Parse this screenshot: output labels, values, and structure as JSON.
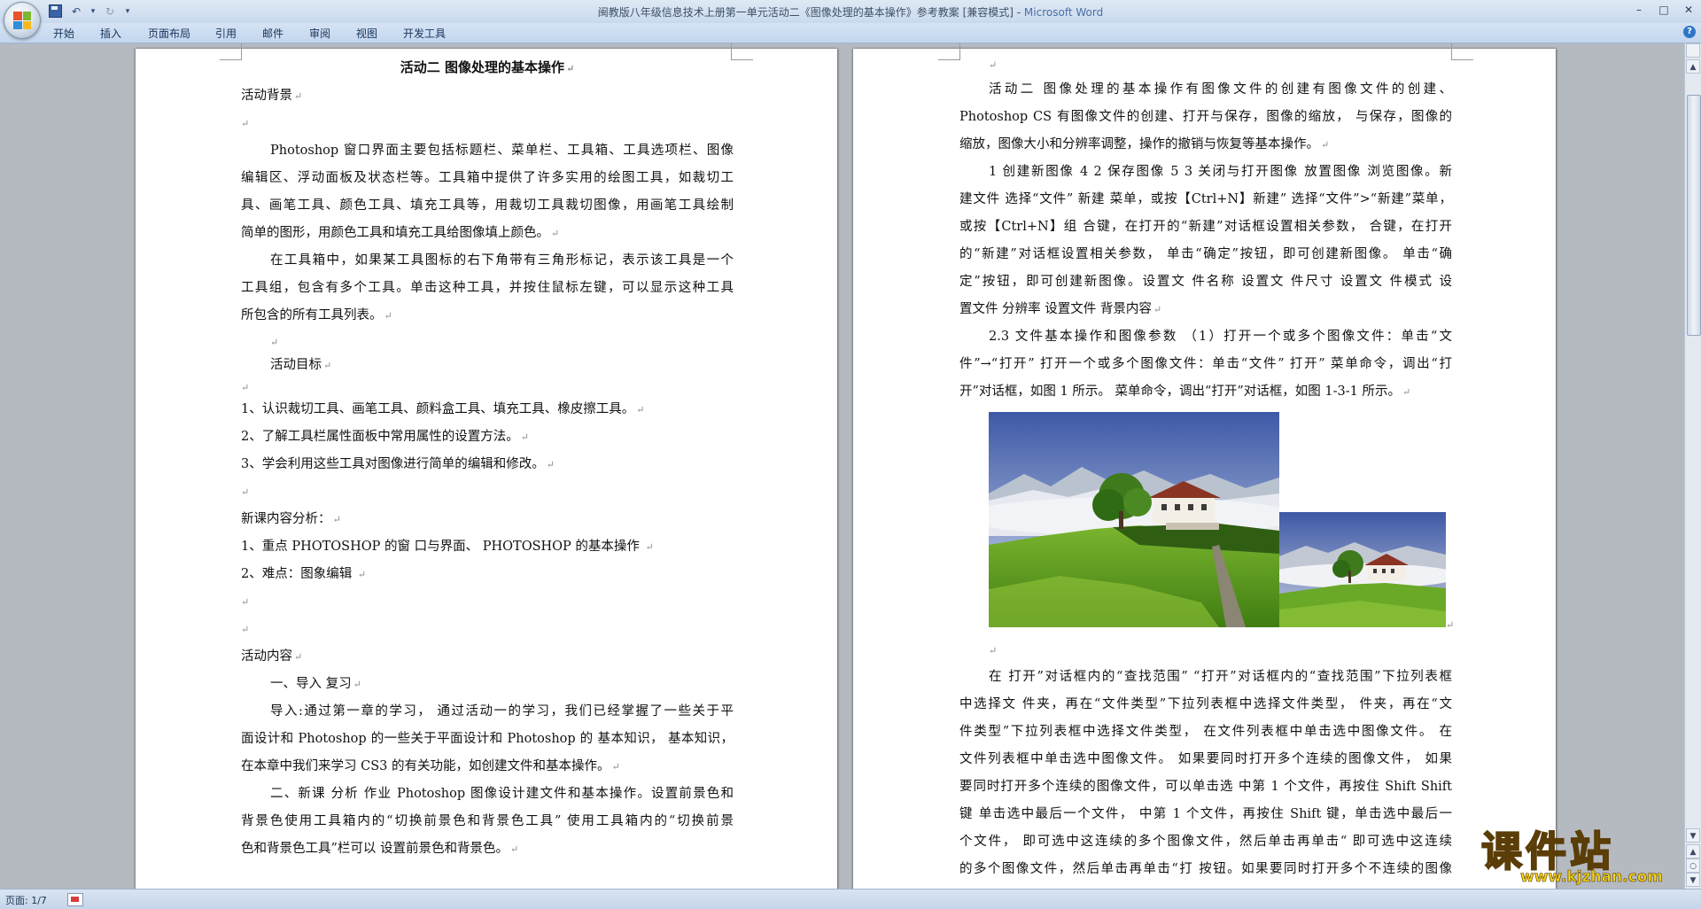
{
  "window": {
    "title": "闽教版八年级信息技术上册第一单元活动二《图像处理的基本操作》参考教案 [兼容模式] - ",
    "app_name": "Microsoft Word"
  },
  "quick_access": {
    "save": "save-icon",
    "undo": "↶",
    "undo_more": "▾",
    "redo": "↻",
    "customize": "▾"
  },
  "window_controls": {
    "minimize": "–",
    "maximize": "□",
    "close": "✕"
  },
  "ribbon": {
    "tabs": [
      "开始",
      "插入",
      "页面布局",
      "引用",
      "邮件",
      "审阅",
      "视图",
      "开发工具"
    ],
    "help": "?"
  },
  "page1": {
    "title": "活动二  图像处理的基本操作",
    "heading_background": "活动背景",
    "para1": [
      "Photoshop 窗口界面主要包括标题栏、菜单栏、工具箱、工具选项栏、图像",
      "编辑区、浮动面板及状态栏等。工具箱中提供了许多实用的绘图工具，如裁切工",
      "具、画笔工具、颜色工具、填充工具等，用裁切工具裁切图像，用画笔工具绘制",
      "简单的图形，用颜色工具和填充工具给图像填上颜色。"
    ],
    "para2": [
      "在工具箱中，如果某工具图标的右下角带有三角形标记，表示该工具是一个",
      "工具组，包含有多个工具。单击这种工具，并按住鼠标左键，可以显示这种工具",
      "所包含的所有工具列表。"
    ],
    "heading_goal": "活动目标",
    "goals": [
      "1、认识裁切工具、画笔工具、颜料盒工具、填充工具、橡皮擦工具。",
      "2、了解工具栏属性面板中常用属性的设置方法。",
      "3、学会利用这些工具对图像进行简单的编辑和修改。"
    ],
    "heading_analysis": "新课内容分析：",
    "analysis": [
      "1、重点  PHOTOSHOP 的窗 口与界面、  PHOTOSHOP 的基本操作 ",
      "2、难点：图象编辑 "
    ],
    "heading_content": "活动内容",
    "section1": "一、导入  复习",
    "para3": [
      "导入:通过第一章的学习，  通过活动一的学习，我们已经掌握了一些关于平",
      "面设计和 Photoshop 的一些关于平面设计和 Photoshop 的  基本知识，  基本知识，",
      "在本章中我们来学习 CS3 的有关功能，如创建文件和基本操作。"
    ],
    "para4": [
      "二、新课  分析  作业  Photoshop 图像设计建文件和基本操作。设置前景色和",
      "背景色使用工具箱内的“切换前景色和背景色工具”  使用工具箱内的“切换前景",
      "色和背景色工具”栏可以  设置前景色和背景色。"
    ]
  },
  "page2": {
    "para1": [
      "活动二  图像处理的基本操作有图像文件的创建有图像文件的创建、",
      "Photoshop  CS 有图像文件的创建、打开与保存，图像的缩放，  与保存，图像的",
      "缩放，图像大小和分辨率调整，操作的撤销与恢复等基本操作。"
    ],
    "para2": [
      "1  创建新图像  4 2  保存图像  5 3  关闭与打开图像  放置图像  浏览图像。新",
      "建文件  选择“文件”  新建  菜单，或按【Ctrl+N】新建”  选择“文件”>“新建”菜单，",
      "或按【Ctrl+N】组  合键，在打开的“新建”对话框设置相关参数，  合键，在打开",
      "的“新建”对话框设置相关参数，  单击“确定”按钮，即可创建新图像。  单击“确",
      "定”按钮，即可创建新图像。设置文  件名称  设置文  件尺寸  设置文  件模式  设",
      "置文件  分辨率  设置文件  背景内容"
    ],
    "para3": [
      "2.3  文件基本操作和图像参数  （1）打开一个或多个图像文件：单击“文",
      "件”→“打开”  打开一个或多个图像文件：单击“文件”  打开”  菜单命令，调出“打",
      "开”对话框，如图 1 所示。  菜单命令，调出“打开”对话框，如图 1-3-1 所示。"
    ],
    "para4": [
      "在  打开”对话框内的“查找范围”  “打开”对话框内的“查找范围”下拉列表框",
      "中选择文  件夹，再在“文件类型”下拉列表框中选择文件类型，  件夹，再在“文",
      "件类型”下拉列表框中选择文件类型，  在文件列表框中单击选中图像文件。  在",
      "文件列表框中单击选中图像文件。  如果要同时打开多个连续的图像文件，  如果",
      "要同时打开多个连续的图像文件，可以单击选  中第 1 个文件，再按住 Shift Shift",
      "键  单击选中最后一个文件，  中第 1 个文件，再按住 Shift 键，单击选中最后一",
      "个文件，  即可选中这连续的多个图像文件，然后单击再单击“  即可选中这连续",
      "的多个图像文件，然后单击再单击“打  按钮。如果要同时打开多个不连续的图像"
    ]
  },
  "statusbar": {
    "page_info": "页面: 1/7"
  },
  "watermark": {
    "main": "课件站",
    "url": "www.kjzhan.com"
  },
  "scrollbar": {
    "up": "▲",
    "down": "▼",
    "prev": "▲",
    "next": "▼",
    "browse": "○"
  },
  "paragraph_mark": "↵",
  "colors": {
    "ribbon_bg": "#c9d9ee",
    "workspace_bg": "#b5bac1",
    "page_bg": "#ffffff",
    "watermark_yellow": "#f2d21a",
    "app_name_blue": "#4a6fa5"
  }
}
